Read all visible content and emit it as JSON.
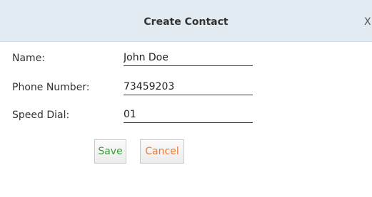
{
  "dialog": {
    "title": "Create Contact",
    "close_label": "X"
  },
  "form": {
    "name": {
      "label": "Name:",
      "value": "John Doe"
    },
    "phone": {
      "label": "Phone Number:",
      "value": "73459203"
    },
    "speed_dial": {
      "label": "Speed Dial:",
      "value": "01"
    }
  },
  "actions": {
    "save_label": "Save",
    "cancel_label": "Cancel"
  },
  "colors": {
    "header_bg": "#e3ebf2",
    "save_text": "#3a9b3a",
    "cancel_text": "#e87a37"
  }
}
